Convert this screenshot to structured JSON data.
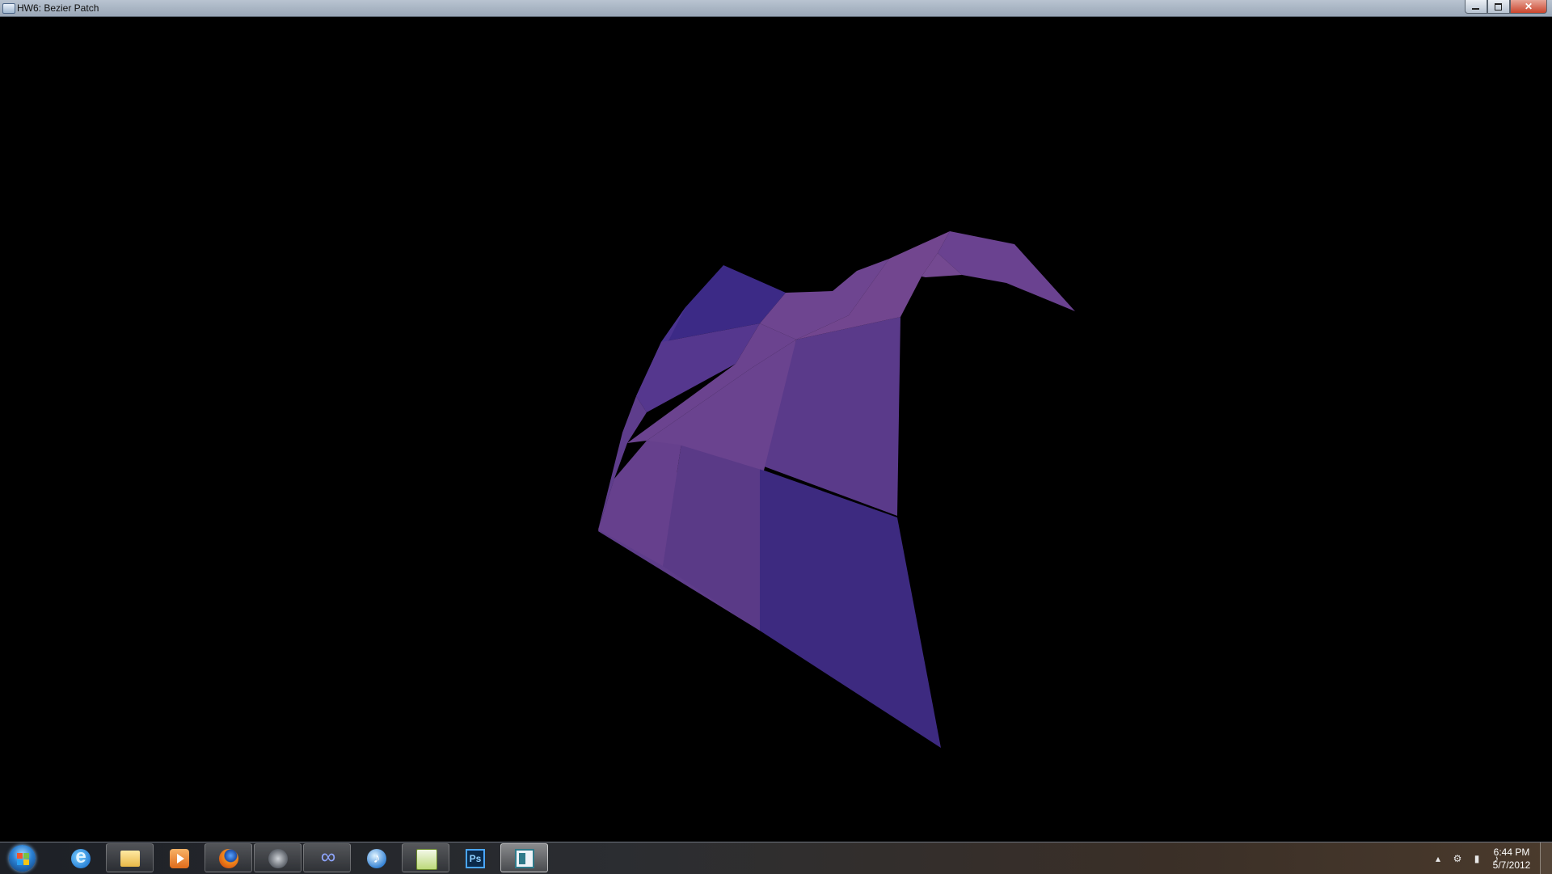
{
  "window": {
    "title": "HW6: Bezier Patch",
    "minimize_icon": "minimize-icon",
    "maximize_icon": "maximize-icon",
    "close_icon": "close-icon",
    "close_glyph": "✕"
  },
  "scene": {
    "object": "bezier-patch",
    "background_color": "#000000",
    "patch_colors": {
      "blue": "#3d2a80",
      "violet": "#5d3a88",
      "lavender": "#74478f"
    }
  },
  "taskbar": {
    "start_icon": "windows-start-orb-icon",
    "items": [
      {
        "icon": "internet-explorer-icon"
      },
      {
        "icon": "file-explorer-icon"
      },
      {
        "icon": "media-player-icon"
      },
      {
        "icon": "firefox-icon"
      },
      {
        "icon": "steam-icon"
      },
      {
        "icon": "infinity-app-icon"
      },
      {
        "icon": "itunes-icon"
      },
      {
        "icon": "notepad-icon"
      },
      {
        "icon": "photoshop-icon",
        "label": "Ps"
      },
      {
        "icon": "window-app-icon",
        "active": true
      }
    ],
    "tray": {
      "icons": [
        "show-hidden-icons-arrow-icon",
        "steam-tray-icon",
        "network-signal-icon",
        "volume-icon"
      ],
      "time": "6:44 PM",
      "date": "5/7/2012"
    }
  }
}
